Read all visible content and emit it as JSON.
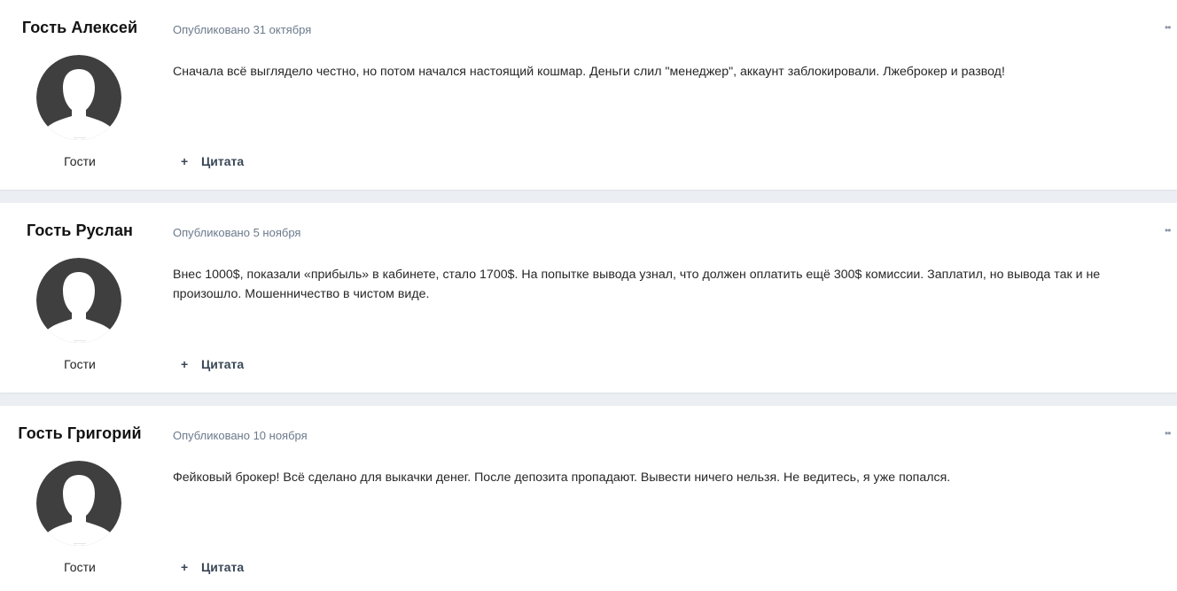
{
  "posts": [
    {
      "author": "Гость Алексей",
      "date": "Опубликовано 31 октября",
      "text": "Сначала всё выглядело честно, но потом начался настоящий кошмар. Деньги слил \"менеджер\", аккаунт заблокировали. Лжеброкер и развод!",
      "group": "Гости",
      "quote_label": "Цитата"
    },
    {
      "author": "Гость Руслан",
      "date": "Опубликовано 5 ноября",
      "text": "Внес 1000$, показали «прибыль» в кабинете, стало 1700$. На попытке вывода узнал, что должен оплатить ещё 300$ комиссии. Заплатил, но вывода так и не произошло. Мошенничество в чистом виде.",
      "group": "Гости",
      "quote_label": "Цитата"
    },
    {
      "author": "Гость Григорий",
      "date": "Опубликовано 10 ноября",
      "text": "Фейковый брокер! Всё сделано для выкачки денег. После депозита пропадают. Вывести ничего нельзя. Не ведитесь, я уже попался.",
      "group": "Гости",
      "quote_label": "Цитата"
    }
  ],
  "icons": {
    "more": "more-options-icon",
    "avatar": "default-user-avatar-icon",
    "quote_plus": "plus-icon"
  },
  "colors": {
    "page_background": "#ebeef2",
    "post_background": "#ffffff",
    "meta_text": "#6b7a8c",
    "avatar_fill": "#3f3f3f",
    "quote_text": "#3a4757"
  }
}
